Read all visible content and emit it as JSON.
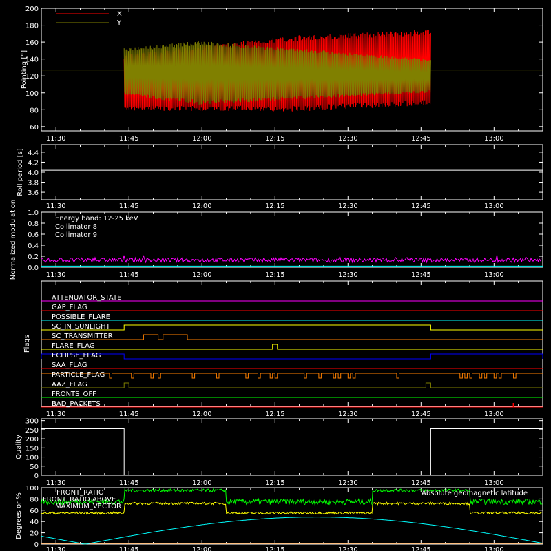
{
  "colors": {
    "background": "#000000",
    "axes": "#ffffff",
    "x": "#ff0000",
    "y": "#808000",
    "white": "#ffffff",
    "cyan": "#00ffff",
    "magenta": "#ff00ff",
    "green": "#00ff00",
    "yellow": "#ffff00",
    "orange": "#ff8000",
    "blue": "#0000ff"
  },
  "time_axis": {
    "ticks": [
      "11:30",
      "11:45",
      "12:00",
      "12:15",
      "12:30",
      "12:45",
      "13:00"
    ],
    "start": "11:27",
    "end": "13:10"
  },
  "chart_data": [
    {
      "type": "line",
      "panel": "pointing",
      "ylabel": "Pointing [°]",
      "ylim": [
        55,
        200
      ],
      "yticks": [
        "60",
        "80",
        "100",
        "120",
        "140",
        "160",
        "180",
        "200"
      ],
      "series": [
        {
          "name": "X",
          "color": "#ff0000",
          "data_start": "11:44",
          "data_end": "12:47",
          "center_start": 112,
          "center_mid": 122,
          "center_end": 130,
          "amp_start": 33,
          "amp_peak": 45
        },
        {
          "name": "Y",
          "color": "#808000",
          "data_start": "11:44",
          "data_end": "12:47",
          "center_start": 125,
          "center_end": 120,
          "amp_start": 28,
          "amp_peak": 38,
          "amp_end": 20
        }
      ],
      "reference_value": 127
    },
    {
      "type": "line",
      "panel": "roll",
      "ylabel": "Roll period [s]",
      "ylim": [
        3.45,
        4.55
      ],
      "yticks": [
        "3.6",
        "3.8",
        "4.0",
        "4.2",
        "4.4"
      ],
      "value": 4.04
    },
    {
      "type": "line",
      "panel": "modulation",
      "ylabel": "Normalized modulation",
      "ylim": [
        0,
        1.0
      ],
      "yticks": [
        "0.0",
        "0.2",
        "0.4",
        "0.6",
        "0.8",
        "1.0"
      ],
      "annotation": "Energy band: 12-25 keV",
      "series": [
        {
          "name": "Collimator 8",
          "color": "#00ffff",
          "level": 0.02
        },
        {
          "name": "Collimator 9",
          "color": "#ff00ff",
          "level": 0.13,
          "noise": 0.04
        }
      ]
    },
    {
      "type": "line",
      "panel": "flags",
      "ylabel": "Flags",
      "flags": [
        {
          "name": "ATTENUATOR_STATE",
          "color": "#ff00ff",
          "level": 0,
          "high": []
        },
        {
          "name": "GAP_FLAG",
          "color": "#ff0000",
          "level": 0,
          "high": []
        },
        {
          "name": "POSSIBLE_FLARE",
          "color": "#00ffff",
          "level": 0,
          "high": []
        },
        {
          "name": "SC_IN_SUNLIGHT",
          "color": "#ffff00",
          "level": 0,
          "high": [
            [
              "11:44",
              "12:47"
            ]
          ]
        },
        {
          "name": "SC_TRANSMITTER",
          "color": "#ff8000",
          "level": 0,
          "high": [
            [
              "11:48",
              "11:51"
            ],
            [
              "11:52",
              "11:57"
            ]
          ]
        },
        {
          "name": "FLARE_FLAG",
          "color": "#ffff00",
          "level": 0,
          "high": [
            [
              "12:14.5",
              "12:15.5"
            ]
          ]
        },
        {
          "name": "ECLIPSE_FLAG",
          "color": "#0000ff",
          "level": 1,
          "high": [
            [
              "11:27",
              "11:44"
            ],
            [
              "12:47",
              "13:10"
            ]
          ]
        },
        {
          "name": "SAA_FLAG",
          "color": "#ff0000",
          "level": 0,
          "high": []
        },
        {
          "name": "PARTICLE_FLAG",
          "color": "#ff8000",
          "level": 1,
          "low": [
            "11:41",
            "11:45.5",
            "11:49.5",
            "11:51",
            "11:58",
            "12:03",
            "12:09",
            "12:11.5",
            "12:14",
            "12:15",
            "12:21",
            "12:24",
            "12:27",
            "12:28",
            "12:30",
            "12:31",
            "12:40",
            "12:53",
            "12:54",
            "12:55",
            "12:57",
            "12:58",
            "13:00",
            "13:01",
            "13:04"
          ],
          "low_width_min": 0.5
        },
        {
          "name": "AAZ_FLAG",
          "color": "#808000",
          "level": 0,
          "high": [
            [
              "11:44",
              "11:45"
            ],
            [
              "12:46",
              "12:47"
            ]
          ]
        },
        {
          "name": "FRONTS_OFF",
          "color": "#00ff00",
          "level": 0,
          "high": []
        },
        {
          "name": "BAD_PACKETS",
          "color": "#ff0000",
          "level": 0,
          "spikes": [
            "13:04"
          ]
        }
      ]
    },
    {
      "type": "line",
      "panel": "quality",
      "ylabel": "Quality",
      "ylim": [
        0,
        310
      ],
      "yticks": [
        "0",
        "50",
        "100",
        "150",
        "200",
        "250",
        "300"
      ],
      "series": [
        {
          "name": "Quality",
          "color": "#ffffff",
          "segments": [
            [
              "11:27",
              "11:44",
              255
            ],
            [
              "11:44",
              "12:47",
              0
            ],
            [
              "12:47",
              "13:10",
              255
            ]
          ]
        }
      ]
    },
    {
      "type": "line",
      "panel": "degrees",
      "ylabel": "Degrees or %",
      "ylim": [
        0,
        100
      ],
      "yticks": [
        "0",
        "20",
        "40",
        "60",
        "80",
        "100"
      ],
      "series": [
        {
          "name": "FRONT_RATIO",
          "color": "#00ff00",
          "segments": [
            [
              "11:27",
              "11:44",
              75
            ],
            [
              "11:44",
              "12:05",
              95
            ],
            [
              "12:05",
              "12:35",
              75
            ],
            [
              "12:35",
              "12:55",
              95
            ],
            [
              "12:55",
              "13:10",
              75
            ]
          ],
          "noise": 10
        },
        {
          "name": "FRONT_RATIO ABOVE",
          "color": "#ffff00",
          "segments": [
            [
              "11:27",
              "11:44",
              55
            ],
            [
              "11:44",
              "12:05",
              72
            ],
            [
              "12:05",
              "12:35",
              55
            ],
            [
              "12:35",
              "12:55",
              72
            ],
            [
              "12:55",
              "13:10",
              55
            ]
          ],
          "noise": 4
        },
        {
          "name": "MAXIMUM_VECTOR",
          "color": "#ff8000",
          "value": 0
        },
        {
          "name": "Absolute geomagnetic latitude",
          "color": "#00ffff",
          "amplitude": 48,
          "period_min": 95,
          "zero_at": "11:36"
        }
      ]
    }
  ]
}
